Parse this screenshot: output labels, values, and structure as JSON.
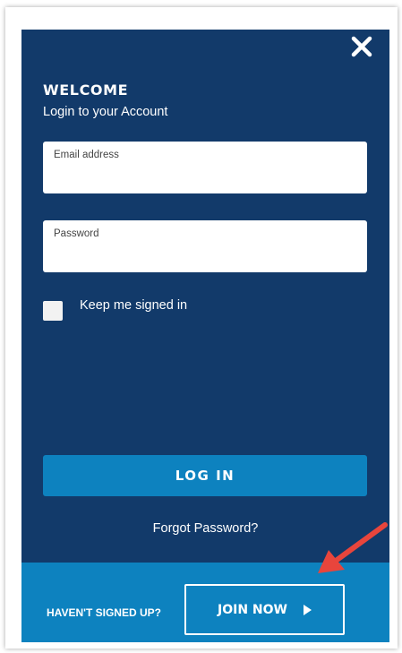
{
  "login": {
    "title": "WELCOME",
    "subtitle": "Login to your Account",
    "email_label": "Email address",
    "email_value": "",
    "password_label": "Password",
    "password_value": "",
    "keep_signed_in_label": "Keep me signed in",
    "keep_signed_in_checked": false,
    "login_button": "LOG IN",
    "forgot_password": "Forgot Password?"
  },
  "footer": {
    "prompt": "HAVEN'T SIGNED UP?",
    "join_button": "JOIN NOW"
  },
  "icons": {
    "close": "close-icon",
    "play": "play-triangle-icon",
    "annotation": "red-arrow-icon"
  },
  "colors": {
    "panel": "#123a6a",
    "accent": "#0d82bf",
    "annotation": "#e8453c"
  }
}
